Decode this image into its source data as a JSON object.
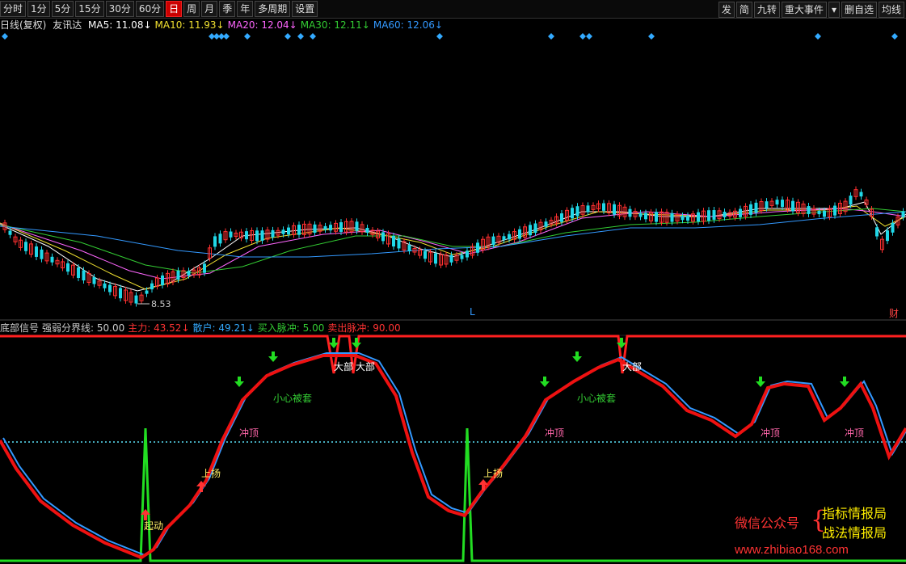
{
  "toolbar": {
    "left": [
      {
        "label": "分时"
      },
      {
        "label": "1分"
      },
      {
        "label": "5分"
      },
      {
        "label": "15分"
      },
      {
        "label": "30分"
      },
      {
        "label": "60分"
      },
      {
        "label": "日",
        "active": true
      },
      {
        "label": "周"
      },
      {
        "label": "月"
      },
      {
        "label": "季"
      },
      {
        "label": "年"
      },
      {
        "label": "多周期"
      },
      {
        "label": "设置"
      }
    ],
    "right": [
      {
        "label": "发"
      },
      {
        "label": "简"
      },
      {
        "label": "九转"
      },
      {
        "label": "重大事件"
      },
      {
        "label": "▾"
      },
      {
        "label": "删自选"
      },
      {
        "label": "均线"
      }
    ]
  },
  "main_chart": {
    "title": "日线(复权)",
    "stock": "友讯达",
    "ma": [
      {
        "label": "MA5: 11.08↓",
        "color": "#ffffff"
      },
      {
        "label": "MA10: 11.93↓",
        "color": "#f0e030"
      },
      {
        "label": "MA20: 12.04↓",
        "color": "#ff66ff"
      },
      {
        "label": "MA30: 12.11↓",
        "color": "#33cc33"
      },
      {
        "label": "MA60: 12.06↓",
        "color": "#3399ff"
      }
    ],
    "low_marker": "8.53",
    "l_marker": "L",
    "cai_marker": "财"
  },
  "indicator": {
    "items": [
      {
        "label": "底部信号",
        "color": "#cccccc"
      },
      {
        "label": "强弱分界线: 50.00",
        "color": "#cccccc"
      },
      {
        "label": "主力: 43.52↓",
        "color": "#ff3333"
      },
      {
        "label": "散户: 49.21↓",
        "color": "#33aaff"
      },
      {
        "label": "买入脉冲: 5.00",
        "color": "#33cc33"
      },
      {
        "label": "卖出脉冲: 90.00",
        "color": "#ff3333"
      }
    ],
    "annotations": {
      "dabu": "大部",
      "xiaoxin": "小心被套",
      "chongding": "冲顶",
      "shangyang": "上扬",
      "qidong": "起动"
    }
  },
  "watermark": {
    "wechat": "微信公众号",
    "name1": "指标情报局",
    "name2": "战法情报局",
    "url": "www.zhibiao168.com"
  }
}
